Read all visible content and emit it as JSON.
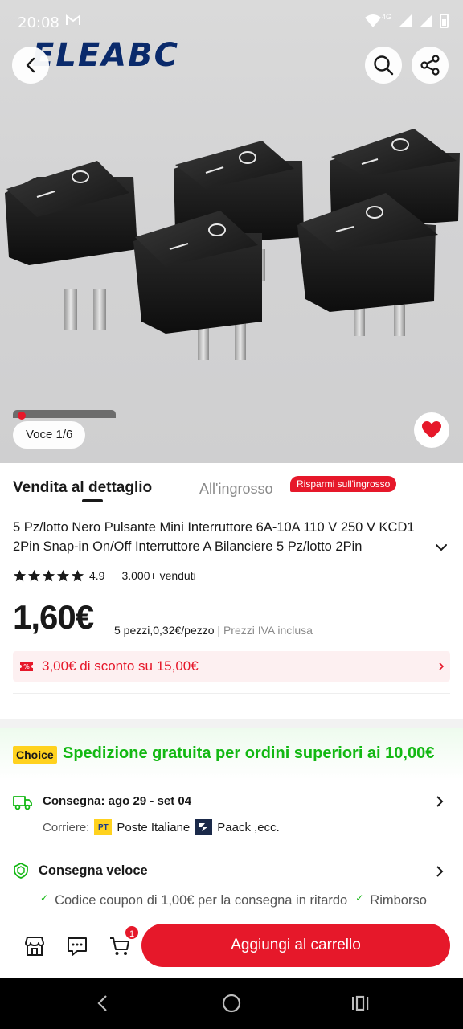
{
  "status_bar": {
    "time": "20:08",
    "mail_icon": "gmail-icon",
    "network_badge": "4G"
  },
  "header": {
    "brand": "ELEABC"
  },
  "gallery": {
    "counter": "Voce 1/6"
  },
  "tabs": {
    "retail": "Vendita al dettaglio",
    "wholesale": "All'ingrosso",
    "wholesale_badge": "Risparmi sull'ingrosso"
  },
  "product": {
    "title": "5 Pz/lotto Nero Pulsante Mini Interruttore 6A-10A 110 V 250 V KCD1 2Pin Snap-in On/Off Interruttore A Bilanciere 5 Pz/lotto 2Pin",
    "rating": "4.9",
    "sold": "3.000+ venduti",
    "price": "1,60€",
    "price_detail": "5 pezzi,0,32€/pezzo",
    "vat_note": "Prezzi IVA inclusa"
  },
  "coupon": {
    "text": "3,00€ di sconto su 15,00€"
  },
  "choice": {
    "badge": "Choice",
    "text": "Spedizione gratuita per ordini superiori ai 10,00€"
  },
  "delivery": {
    "label": "Consegna: ago 29 - set 04",
    "carrier_prefix": "Corriere:",
    "carrier_1_logo": "PT",
    "carrier_1": "Poste Italiane",
    "carrier_2": "Paack ,ecc."
  },
  "fast_delivery": {
    "label": "Consegna veloce",
    "perks": [
      "Codice coupon di 1,00€ per la consegna in ritardo",
      "Rimborso"
    ]
  },
  "action_bar": {
    "cart_count": "1",
    "add_to_cart": "Aggiungi al carrello"
  },
  "colors": {
    "accent": "#e6182a",
    "choice_green": "#12b812",
    "choice_yellow": "#ffd21e"
  }
}
